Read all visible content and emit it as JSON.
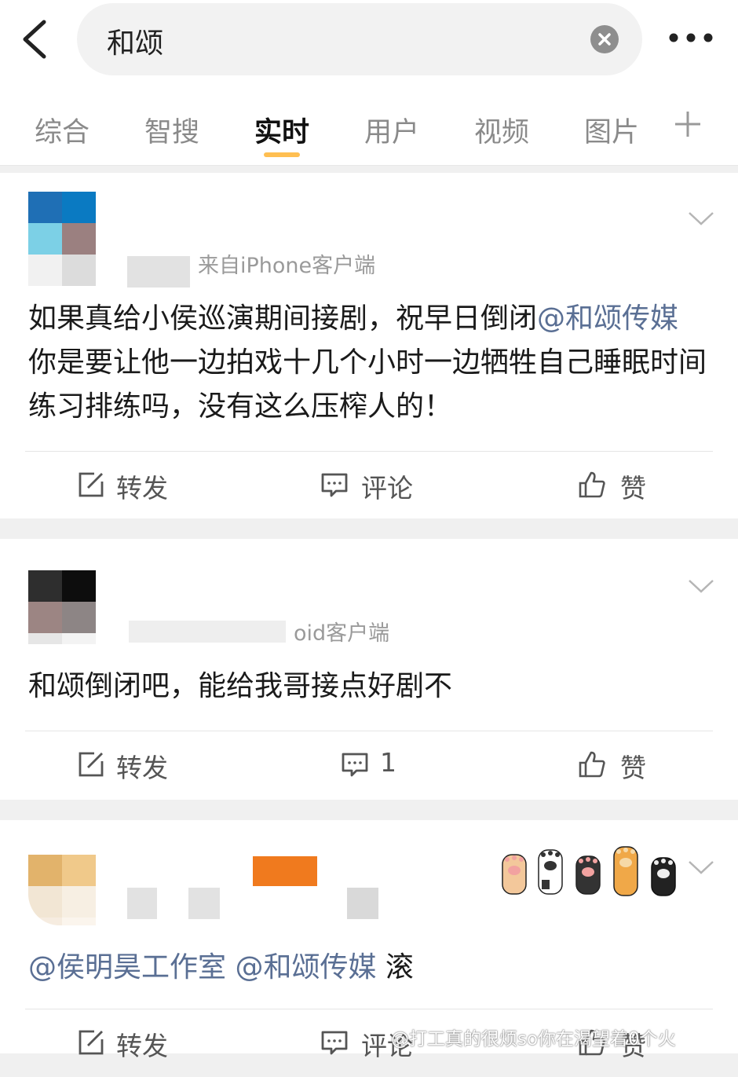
{
  "search": {
    "query": "和颂"
  },
  "tabs": [
    {
      "label": "综合"
    },
    {
      "label": "智搜"
    },
    {
      "label": "实时"
    },
    {
      "label": "用户"
    },
    {
      "label": "视频"
    },
    {
      "label": "图片"
    }
  ],
  "active_tab": "实时",
  "posts": [
    {
      "source": "来自iPhone客户端",
      "text_prefix": "如果真给小侯巡演期间接剧，祝早日倒闭",
      "mention": "@和颂传媒",
      "text_suffix": " 你是要让他一边拍戏十几个小时一边牺牲自己睡眠时间练习排练吗，没有这么压榨人的！",
      "repost_label": "转发",
      "comment_label": "评论",
      "like_label": "赞"
    },
    {
      "source": "oid客户端",
      "text": "和颂倒闭吧，能给我哥接点好剧不",
      "repost_label": "转发",
      "comment_label": "1",
      "like_label": "赞"
    },
    {
      "mention1": "@侯明昊工作室",
      "mention2": "@和颂传媒",
      "text_suffix": " 滚",
      "repost_label": "转发",
      "comment_label": "评论",
      "like_label": "赞"
    }
  ],
  "watermark": "@打工真的很烦so你在渴望着0个火",
  "colors": {
    "accent_underline": "#ffbf52",
    "mention": "#5a6f94"
  }
}
